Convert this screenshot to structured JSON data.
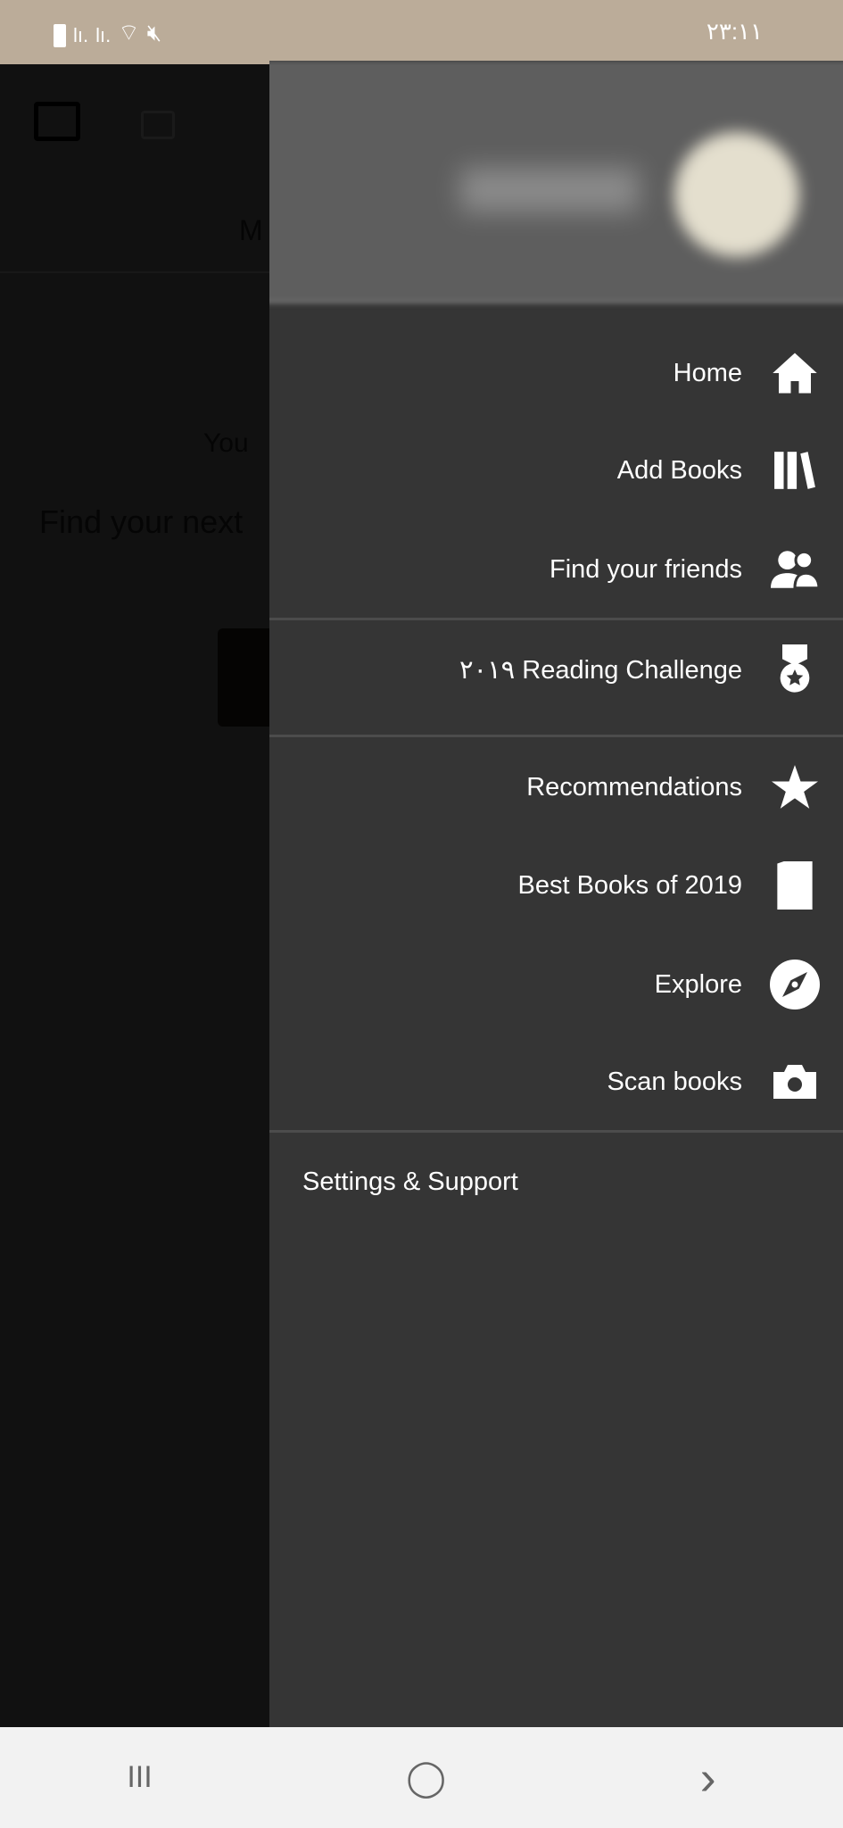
{
  "status_bar": {
    "time": "٢٣:١١",
    "icons": [
      "battery-icon",
      "signal-icon",
      "signal-icon",
      "wifi-icon",
      "mute-icon"
    ]
  },
  "background": {
    "partial_tab": "M",
    "partial_text_1": "You",
    "partial_text_2": "Find your next"
  },
  "drawer": {
    "items": [
      {
        "label": "Home",
        "icon": "home-icon"
      },
      {
        "label": "Add Books",
        "icon": "books-icon"
      },
      {
        "label": "Find your friends",
        "icon": "friends-icon"
      },
      {
        "label": "٢٠١٩ Reading Challenge",
        "icon": "medal-icon"
      },
      {
        "label": "Recommendations",
        "icon": "star-icon"
      },
      {
        "label": "Best Books of 2019",
        "icon": "book-icon"
      },
      {
        "label": "Explore",
        "icon": "compass-icon"
      },
      {
        "label": "Scan books",
        "icon": "camera-icon"
      }
    ],
    "settings_label": "Settings & Support"
  },
  "nav_bar": {
    "recents": "III",
    "home": "◯",
    "back": "›"
  }
}
